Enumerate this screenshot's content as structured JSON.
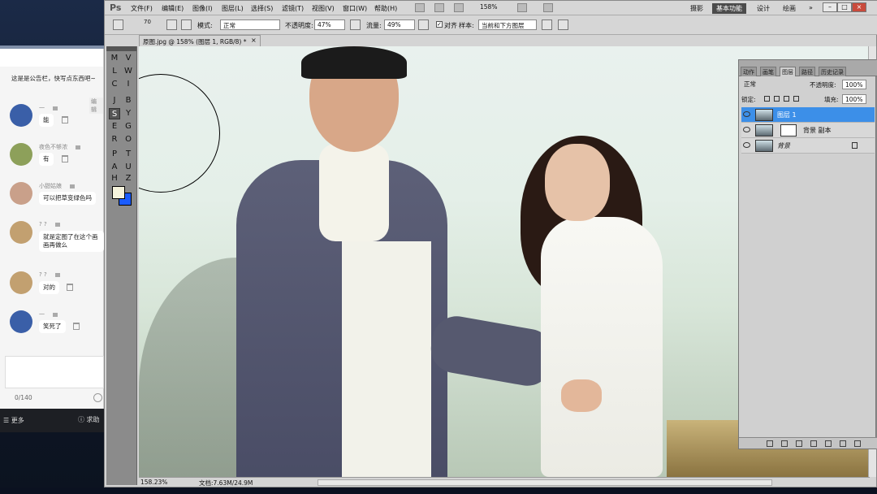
{
  "chat": {
    "notice": "这是是公告栏，快写点东西吧~",
    "edit_label": "编辑",
    "messages": [
      {
        "nick": "一",
        "text": "能",
        "avatar_color": "#3a5fa8"
      },
      {
        "nick": "夜色不够浓",
        "text": "有",
        "avatar_color": "#8da05a"
      },
      {
        "nick": "小甜姑娘",
        "text": "可以把草变绿色吗",
        "avatar_color": "#c9a08a"
      },
      {
        "nick": "? ?",
        "text": "就是定图了在这个画画再做么",
        "avatar_color": "#c2a070"
      },
      {
        "nick": "? ?",
        "text": "对的",
        "avatar_color": "#c2a070"
      },
      {
        "nick": "一",
        "text": "笑死了",
        "avatar_color": "#3a5fa8"
      }
    ],
    "char_count": "0/140",
    "more_label": "更多",
    "help_label": "求助"
  },
  "ps": {
    "logo": "Ps",
    "menus": [
      "文件(F)",
      "编辑(E)",
      "图像(I)",
      "图层(L)",
      "选择(S)",
      "滤镜(T)",
      "视图(V)",
      "窗口(W)",
      "帮助(H)"
    ],
    "zoom": "158%",
    "workspaces": [
      "摄影",
      "基本功能",
      "设计",
      "绘画"
    ],
    "more": "»",
    "options": {
      "brush_size": "70",
      "mode_label": "模式:",
      "mode_value": "正常",
      "opacity_label": "不透明度:",
      "opacity_value": "47%",
      "flow_label": "流量:",
      "flow_value": "49%",
      "aligned_label": "对齐",
      "sample_label": "样本:",
      "sample_value": "当前和下方图层"
    },
    "doc_tab": "原图.jpg @ 158% (图层 1, RGB/8) *",
    "doc_close": "×",
    "status": {
      "zoom": "158.23%",
      "doc": "文档:7.63M/24.9M"
    },
    "layers_panel": {
      "tabs": [
        "动作",
        "画笔",
        "图层",
        "路径",
        "历史记录"
      ],
      "blend_mode": "正常",
      "opacity_label": "不透明度:",
      "opacity_value": "100%",
      "lock_label": "锁定:",
      "fill_label": "填充:",
      "fill_value": "100%",
      "layers": [
        {
          "name": "图层 1",
          "selected": true
        },
        {
          "name": "背景 副本",
          "selected": false
        },
        {
          "name": "背景",
          "selected": false
        }
      ]
    },
    "tools": [
      "M",
      "V",
      "L",
      "W",
      "C",
      "I",
      "J",
      "B",
      "S",
      "Y",
      "E",
      "G",
      "R",
      "O",
      "P",
      "T",
      "A",
      "U",
      "H",
      "Z"
    ]
  }
}
